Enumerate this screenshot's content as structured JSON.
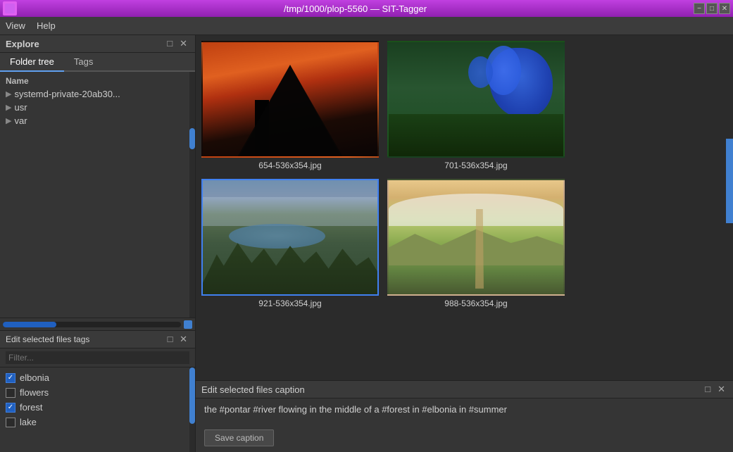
{
  "titlebar": {
    "title": "/tmp/1000/plop-5560 — SIT-Tagger",
    "win_min": "−",
    "win_max": "□",
    "win_close": "✕"
  },
  "menubar": {
    "items": [
      "View",
      "Help"
    ]
  },
  "explore": {
    "title": "Explore",
    "minimize_label": "□",
    "close_label": "✕"
  },
  "folder_tabs": {
    "tabs": [
      {
        "label": "Folder tree",
        "active": true
      },
      {
        "label": "Tags",
        "active": false
      }
    ]
  },
  "tree": {
    "header": "Name",
    "items": [
      {
        "label": "systemd-private-20ab30...",
        "indent": 1,
        "arrow": "▶"
      },
      {
        "label": "usr",
        "indent": 0,
        "arrow": "▶"
      },
      {
        "label": "var",
        "indent": 0,
        "arrow": "▶"
      }
    ]
  },
  "tags_panel": {
    "title": "Edit selected files tags",
    "minimize_label": "□",
    "close_label": "✕",
    "filter_placeholder": "Filter...",
    "tags": [
      {
        "label": "elbonia",
        "checked": true
      },
      {
        "label": "flowers",
        "checked": false
      },
      {
        "label": "forest",
        "checked": true
      },
      {
        "label": "lake",
        "checked": false
      }
    ]
  },
  "images": [
    {
      "filename": "654-536x354.jpg",
      "selected": false
    },
    {
      "filename": "701-536x354.jpg",
      "selected": false
    },
    {
      "filename": "921-536x354.jpg",
      "selected": true
    },
    {
      "filename": "988-536x354.jpg",
      "selected": false
    }
  ],
  "caption_panel": {
    "title": "Edit selected files caption",
    "minimize_label": "□",
    "close_label": "✕",
    "caption_text": "the #pontar #river flowing in the middle of a #forest in #elbonia in #summer",
    "save_label": "Save caption"
  }
}
